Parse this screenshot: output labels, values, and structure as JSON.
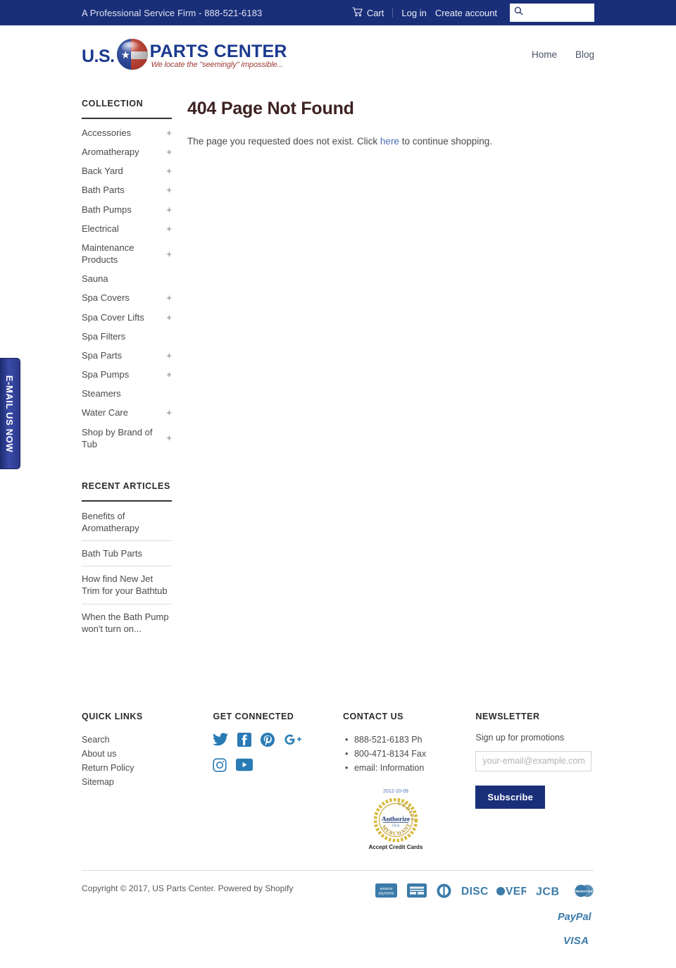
{
  "topbar": {
    "tagline": "A Professional Service Firm - 888-521-6183",
    "cart_label": "Cart",
    "login_label": "Log in",
    "create_account_label": "Create account",
    "search_value": "",
    "search_placeholder": "",
    "background_color": "#1a2f7a"
  },
  "email_tab": {
    "label": "E-MAIL US NOW"
  },
  "logo": {
    "us": "U.S.",
    "parts_center": "PARTS CENTER",
    "slogan": "We locate the \"seemingly\" impossible...",
    "brand_color": "#1b3a8f",
    "slogan_color": "#9b3a36"
  },
  "nav": {
    "items": [
      {
        "label": "Home"
      },
      {
        "label": "Blog"
      }
    ]
  },
  "sidebar": {
    "collection_heading": "COLLECTION",
    "categories": [
      {
        "label": "Accessories",
        "expand": "+"
      },
      {
        "label": "Aromatherapy",
        "expand": "+"
      },
      {
        "label": "Back Yard",
        "expand": "+"
      },
      {
        "label": "Bath Parts",
        "expand": "+"
      },
      {
        "label": "Bath Pumps",
        "expand": "+"
      },
      {
        "label": "Electrical",
        "expand": "+"
      },
      {
        "label": "Maintenance Products",
        "expand": "+"
      },
      {
        "label": "Sauna",
        "expand": ""
      },
      {
        "label": "Spa Covers",
        "expand": "+"
      },
      {
        "label": "Spa Cover Lifts",
        "expand": "+"
      },
      {
        "label": "Spa Filters",
        "expand": ""
      },
      {
        "label": "Spa Parts",
        "expand": "+"
      },
      {
        "label": "Spa Pumps",
        "expand": "+"
      },
      {
        "label": "Steamers",
        "expand": ""
      },
      {
        "label": "Water Care",
        "expand": "+"
      },
      {
        "label": "Shop by Brand of Tub",
        "expand": "+"
      }
    ],
    "recent_heading": "RECENT ARTICLES",
    "articles": [
      {
        "label": "Benefits of Aromatherapy"
      },
      {
        "label": "Bath Tub Parts"
      },
      {
        "label": "How find New Jet Trim for your Bathtub"
      },
      {
        "label": "When the Bath Pump won't turn on..."
      }
    ]
  },
  "main": {
    "title": "404 Page Not Found",
    "body_before": "The page you requested does not exist. Click ",
    "body_link": "here",
    "body_after": " to continue shopping."
  },
  "footer": {
    "quick_links": {
      "heading": "QUICK LINKS",
      "items": [
        {
          "label": "Search"
        },
        {
          "label": "About us"
        },
        {
          "label": "Return Policy"
        },
        {
          "label": "Sitemap"
        }
      ]
    },
    "social": {
      "heading": "GET CONNECTED",
      "items": [
        {
          "name": "twitter"
        },
        {
          "name": "facebook"
        },
        {
          "name": "pinterest"
        },
        {
          "name": "google-plus"
        },
        {
          "name": "instagram"
        },
        {
          "name": "youtube"
        }
      ]
    },
    "contact": {
      "heading": "CONTACT US",
      "items": [
        {
          "label": "888-521-6183 Ph"
        },
        {
          "label": "800-471-8134 Fax"
        },
        {
          "label": "email: Information"
        }
      ],
      "badge_date": "2012-10-09",
      "badge_top": "VERIFIED",
      "badge_brand_1": "Authorize",
      "badge_brand_2": ".Net",
      "badge_click": "Click",
      "badge_bottom": "MERCHANT",
      "badge_caption": "Accept Credit Cards"
    },
    "newsletter": {
      "heading": "NEWSLETTER",
      "subtitle": "Sign up for promotions",
      "email_value": "",
      "email_placeholder": "your-email@example.com",
      "subscribe_label": "Subscribe",
      "button_color": "#1a2f7a"
    }
  },
  "bottom": {
    "copyright": "Copyright © 2017, US Parts Center. Powered by Shopify",
    "payments": [
      {
        "name": "amazon-payments",
        "label": "amazon payments"
      },
      {
        "name": "american-express",
        "label": "AMERICAN EXPRESS"
      },
      {
        "name": "diners-club",
        "label": "Diners Club"
      },
      {
        "name": "discover",
        "label": "DISCOVER"
      },
      {
        "name": "jcb",
        "label": "JCB"
      },
      {
        "name": "master",
        "label": "MasterCard"
      },
      {
        "name": "paypal",
        "label": "PayPal"
      },
      {
        "name": "visa",
        "label": "VISA"
      }
    ],
    "payment_color": "#3b7ba8"
  }
}
